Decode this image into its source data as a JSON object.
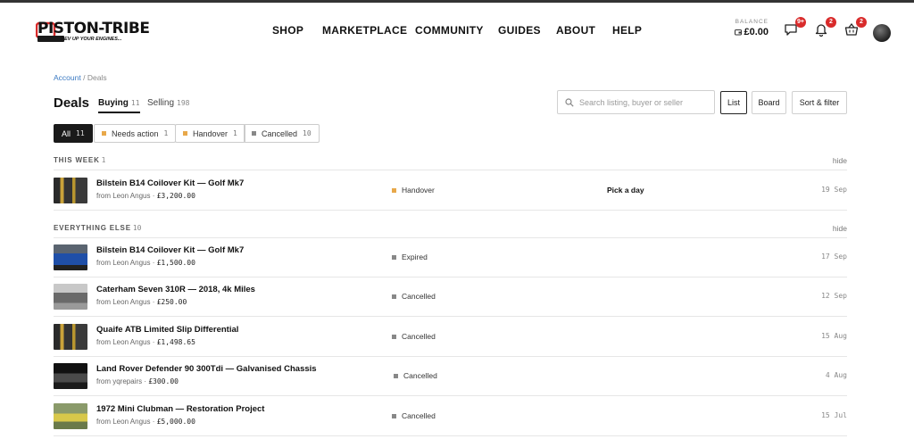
{
  "brand": {
    "name": "PISTON-TRIBE",
    "tagline": "REV UP YOUR ENGINES..."
  },
  "nav": [
    "SHOP",
    "MARKETPLACE",
    "COMMUNITY",
    "GUIDES",
    "ABOUT",
    "HELP"
  ],
  "balance": {
    "label": "BALANCE",
    "amount": "£0.00"
  },
  "badges": {
    "messages": "9+",
    "notifications": "2",
    "basket": "2"
  },
  "breadcrumb": {
    "link": "Account",
    "separator": "/",
    "current": "Deals"
  },
  "page": {
    "title": "Deals"
  },
  "tabs": [
    {
      "label": "Buying",
      "count": "11"
    },
    {
      "label": "Selling",
      "count": "198"
    }
  ],
  "search": {
    "placeholder": "Search listing, buyer or seller"
  },
  "view_buttons": {
    "list": "List",
    "board": "Board",
    "sort": "Sort & filter"
  },
  "filters": [
    {
      "label": "All",
      "count": "11",
      "color": ""
    },
    {
      "label": "Needs action",
      "count": "1",
      "color": "#e8a84a"
    },
    {
      "label": "Handover",
      "count": "1",
      "color": "#e8a84a"
    },
    {
      "label": "Cancelled",
      "count": "10",
      "color": "#888888"
    }
  ],
  "sections": {
    "this_week": {
      "label": "THIS WEEK",
      "count": "1",
      "hide": "hide"
    },
    "everything_else": {
      "label": "EVERYTHING ELSE",
      "count": "10",
      "hide": "hide"
    }
  },
  "deals": [
    {
      "title": "Bilstein B14 Coilover Kit — Golf Mk7",
      "from": "from Leon Angus",
      "price": "£3,200.00",
      "status": "Handover",
      "status_color": "#e8a84a",
      "action": "Pick a day",
      "date": "19 Sep",
      "thumb": "coilovers"
    },
    {
      "title": "Bilstein B14 Coilover Kit — Golf Mk7",
      "from": "from Leon Angus",
      "price": "£1,500.00",
      "status": "Expired",
      "status_color": "#888888",
      "action": "",
      "date": "17 Sep",
      "thumb": "blue-car"
    },
    {
      "title": "Caterham Seven 310R — 2018, 4k Miles",
      "from": "from Leon Angus",
      "price": "£250.00",
      "status": "Cancelled",
      "status_color": "#888888",
      "action": "",
      "date": "12 Sep",
      "thumb": "grey-car"
    },
    {
      "title": "Quaife ATB Limited Slip Differential",
      "from": "from Leon Angus",
      "price": "£1,498.65",
      "status": "Cancelled",
      "status_color": "#888888",
      "action": "",
      "date": "15 Aug",
      "thumb": "coilovers"
    },
    {
      "title": "Land Rover Defender 90 300Tdi — Galvanised Chassis",
      "from": "from yqrepairs",
      "price": "£300.00",
      "status": "Cancelled",
      "status_color": "#888888",
      "action": "",
      "date": "4 Aug",
      "thumb": "dark-car"
    },
    {
      "title": "1972 Mini Clubman — Restoration Project",
      "from": "from Leon Angus",
      "price": "£5,000.00",
      "status": "Cancelled",
      "status_color": "#888888",
      "action": "",
      "date": "15 Jul",
      "thumb": "yellow-car"
    }
  ]
}
